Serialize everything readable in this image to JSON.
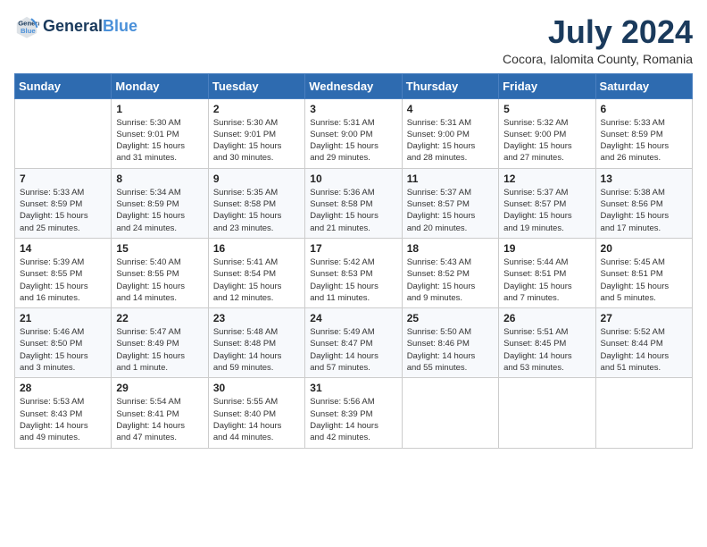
{
  "logo": {
    "line1": "General",
    "line2": "Blue"
  },
  "title": {
    "month_year": "July 2024",
    "location": "Cocora, Ialomita County, Romania"
  },
  "weekdays": [
    "Sunday",
    "Monday",
    "Tuesday",
    "Wednesday",
    "Thursday",
    "Friday",
    "Saturday"
  ],
  "weeks": [
    [
      {
        "day": "",
        "info": ""
      },
      {
        "day": "1",
        "info": "Sunrise: 5:30 AM\nSunset: 9:01 PM\nDaylight: 15 hours\nand 31 minutes."
      },
      {
        "day": "2",
        "info": "Sunrise: 5:30 AM\nSunset: 9:01 PM\nDaylight: 15 hours\nand 30 minutes."
      },
      {
        "day": "3",
        "info": "Sunrise: 5:31 AM\nSunset: 9:00 PM\nDaylight: 15 hours\nand 29 minutes."
      },
      {
        "day": "4",
        "info": "Sunrise: 5:31 AM\nSunset: 9:00 PM\nDaylight: 15 hours\nand 28 minutes."
      },
      {
        "day": "5",
        "info": "Sunrise: 5:32 AM\nSunset: 9:00 PM\nDaylight: 15 hours\nand 27 minutes."
      },
      {
        "day": "6",
        "info": "Sunrise: 5:33 AM\nSunset: 8:59 PM\nDaylight: 15 hours\nand 26 minutes."
      }
    ],
    [
      {
        "day": "7",
        "info": "Sunrise: 5:33 AM\nSunset: 8:59 PM\nDaylight: 15 hours\nand 25 minutes."
      },
      {
        "day": "8",
        "info": "Sunrise: 5:34 AM\nSunset: 8:59 PM\nDaylight: 15 hours\nand 24 minutes."
      },
      {
        "day": "9",
        "info": "Sunrise: 5:35 AM\nSunset: 8:58 PM\nDaylight: 15 hours\nand 23 minutes."
      },
      {
        "day": "10",
        "info": "Sunrise: 5:36 AM\nSunset: 8:58 PM\nDaylight: 15 hours\nand 21 minutes."
      },
      {
        "day": "11",
        "info": "Sunrise: 5:37 AM\nSunset: 8:57 PM\nDaylight: 15 hours\nand 20 minutes."
      },
      {
        "day": "12",
        "info": "Sunrise: 5:37 AM\nSunset: 8:57 PM\nDaylight: 15 hours\nand 19 minutes."
      },
      {
        "day": "13",
        "info": "Sunrise: 5:38 AM\nSunset: 8:56 PM\nDaylight: 15 hours\nand 17 minutes."
      }
    ],
    [
      {
        "day": "14",
        "info": "Sunrise: 5:39 AM\nSunset: 8:55 PM\nDaylight: 15 hours\nand 16 minutes."
      },
      {
        "day": "15",
        "info": "Sunrise: 5:40 AM\nSunset: 8:55 PM\nDaylight: 15 hours\nand 14 minutes."
      },
      {
        "day": "16",
        "info": "Sunrise: 5:41 AM\nSunset: 8:54 PM\nDaylight: 15 hours\nand 12 minutes."
      },
      {
        "day": "17",
        "info": "Sunrise: 5:42 AM\nSunset: 8:53 PM\nDaylight: 15 hours\nand 11 minutes."
      },
      {
        "day": "18",
        "info": "Sunrise: 5:43 AM\nSunset: 8:52 PM\nDaylight: 15 hours\nand 9 minutes."
      },
      {
        "day": "19",
        "info": "Sunrise: 5:44 AM\nSunset: 8:51 PM\nDaylight: 15 hours\nand 7 minutes."
      },
      {
        "day": "20",
        "info": "Sunrise: 5:45 AM\nSunset: 8:51 PM\nDaylight: 15 hours\nand 5 minutes."
      }
    ],
    [
      {
        "day": "21",
        "info": "Sunrise: 5:46 AM\nSunset: 8:50 PM\nDaylight: 15 hours\nand 3 minutes."
      },
      {
        "day": "22",
        "info": "Sunrise: 5:47 AM\nSunset: 8:49 PM\nDaylight: 15 hours\nand 1 minute."
      },
      {
        "day": "23",
        "info": "Sunrise: 5:48 AM\nSunset: 8:48 PM\nDaylight: 14 hours\nand 59 minutes."
      },
      {
        "day": "24",
        "info": "Sunrise: 5:49 AM\nSunset: 8:47 PM\nDaylight: 14 hours\nand 57 minutes."
      },
      {
        "day": "25",
        "info": "Sunrise: 5:50 AM\nSunset: 8:46 PM\nDaylight: 14 hours\nand 55 minutes."
      },
      {
        "day": "26",
        "info": "Sunrise: 5:51 AM\nSunset: 8:45 PM\nDaylight: 14 hours\nand 53 minutes."
      },
      {
        "day": "27",
        "info": "Sunrise: 5:52 AM\nSunset: 8:44 PM\nDaylight: 14 hours\nand 51 minutes."
      }
    ],
    [
      {
        "day": "28",
        "info": "Sunrise: 5:53 AM\nSunset: 8:43 PM\nDaylight: 14 hours\nand 49 minutes."
      },
      {
        "day": "29",
        "info": "Sunrise: 5:54 AM\nSunset: 8:41 PM\nDaylight: 14 hours\nand 47 minutes."
      },
      {
        "day": "30",
        "info": "Sunrise: 5:55 AM\nSunset: 8:40 PM\nDaylight: 14 hours\nand 44 minutes."
      },
      {
        "day": "31",
        "info": "Sunrise: 5:56 AM\nSunset: 8:39 PM\nDaylight: 14 hours\nand 42 minutes."
      },
      {
        "day": "",
        "info": ""
      },
      {
        "day": "",
        "info": ""
      },
      {
        "day": "",
        "info": ""
      }
    ]
  ]
}
